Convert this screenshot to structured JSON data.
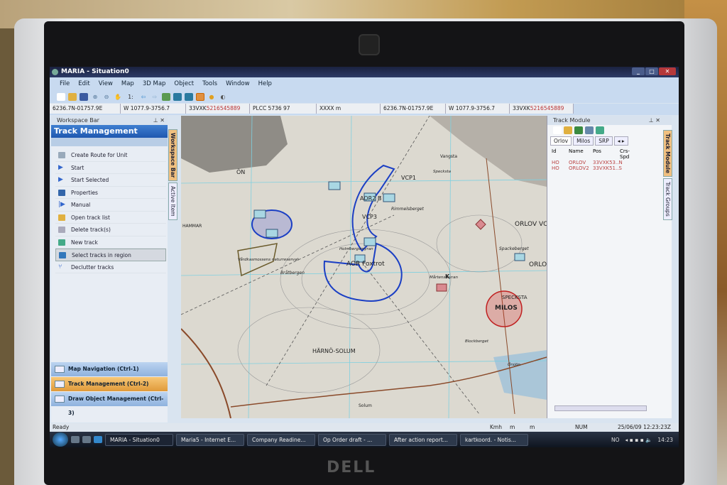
{
  "window": {
    "title": "MARIA - Situation0"
  },
  "menu": [
    "File",
    "Edit",
    "View",
    "Map",
    "3D Map",
    "Object",
    "Tools",
    "Window",
    "Help"
  ],
  "toolbar": {
    "scale_label": "1:"
  },
  "coordinates": {
    "geo": "6236.7N-01757.9E",
    "grid": "W 1077.9-3756.7",
    "mgrs_prefix": "33VXK",
    "mgrs_digits": "5216545889",
    "plcc": "PLCC 5736 97",
    "alt": "XXXX m",
    "geo2": "6236.7N-01757.9E",
    "grid2": "W 1077.9-3756.7",
    "mgrs2_prefix": "33VXK",
    "mgrs2_digits": "5216545889"
  },
  "workspace": {
    "header": "Workspace Bar",
    "title": "Track Management",
    "actions": [
      "Create Route for Unit",
      "Start",
      "Start Selected",
      "Properties",
      "Manual",
      "Open track list",
      "Delete track(s)",
      "New track",
      "Select tracks in region",
      "Declutter tracks"
    ],
    "selected_action": "Select tracks in region",
    "vtabs": [
      "Workspace Bar",
      "Active Item"
    ],
    "nav": [
      "Map Navigation (Ctrl-1)",
      "Track Management (Ctrl-2)",
      "Draw Object Management (Ctrl-3)"
    ],
    "active_nav": "Track Management (Ctrl-2)"
  },
  "map": {
    "labels": [
      "ÖN",
      "HAMMAR",
      "Vårdkasmossens naturreservat",
      "AOR2 B",
      "VCP1",
      "VCP3",
      "Rimmelsberget",
      "AOR Foxtrot",
      "Holmbergsmyran",
      "Bråtbergen",
      "Mårtensmyran",
      "K",
      "ORLOV VCP",
      "ORLOV",
      "Spackeberget",
      "SPECKSTA",
      "MILOS",
      "HÄRNÖ-SOLUM",
      "Solum",
      "Vangsta",
      "Specksta",
      "Blockberget",
      "Örsjön"
    ]
  },
  "track_module": {
    "header": "Track Module",
    "tabs": [
      "Orlov",
      "Milos",
      "SRP"
    ],
    "columns": [
      "Id",
      "Name",
      "Pos",
      "Crs-Spd"
    ],
    "rows": [
      {
        "id": "HO",
        "name": "ORLOV",
        "pos": "33VXK53..N",
        "crs": ""
      },
      {
        "id": "HO",
        "name": "ORLOV2",
        "pos": "33VXK51..S",
        "crs": ""
      }
    ],
    "vtabs": [
      "Track Module",
      "Track Groups"
    ]
  },
  "status": {
    "text": "Ready",
    "speed": "Kmh",
    "m1": "m",
    "m2": "m",
    "num": "NUM",
    "datetime": "25/06/09  12:23:23Z"
  },
  "taskbar": {
    "tasks": [
      "MARIA - Situation0",
      "Maria5 - Internet E...",
      "Company Readine...",
      "Op Order draft - ...",
      "After action report...",
      "kartkoord. - Notis..."
    ],
    "lang": "NO",
    "clock": "14:23"
  },
  "colors": {
    "accent": "#1f58b0",
    "active_nav": "#e09a3a",
    "enemy": "#b33333",
    "friendly_zone": "#1b3fc4"
  }
}
